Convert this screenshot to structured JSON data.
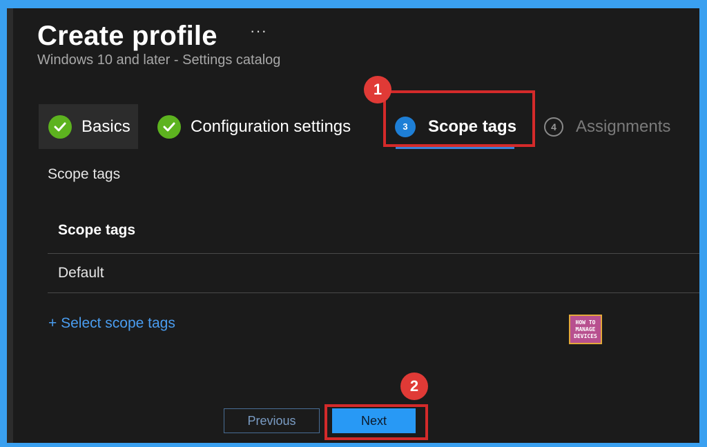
{
  "header": {
    "title": "Create profile",
    "more_label": "···",
    "subtitle": "Windows 10 and later - Settings catalog"
  },
  "wizard": {
    "tabs": [
      {
        "label": "Basics",
        "state": "complete"
      },
      {
        "label": "Configuration settings",
        "state": "complete"
      },
      {
        "label": "Scope tags",
        "number": "3",
        "state": "active"
      },
      {
        "label": "Assignments",
        "number": "4",
        "state": "inactive"
      }
    ]
  },
  "content": {
    "section_label": "Scope tags",
    "table": {
      "column_header": "Scope tags",
      "rows": [
        "Default"
      ]
    },
    "select_link": "+ Select scope tags"
  },
  "annotations": {
    "callout_1": "1",
    "callout_2": "2"
  },
  "watermark": {
    "line1": "HOW TO",
    "line2": "MANAGE",
    "line3": "DEVICES"
  },
  "footer": {
    "previous_label": "Previous",
    "next_label": "Next"
  },
  "colors": {
    "background": "#1b1b1b",
    "accent": "#2899f5",
    "success": "#5db31f",
    "highlight": "#d42a2a"
  }
}
